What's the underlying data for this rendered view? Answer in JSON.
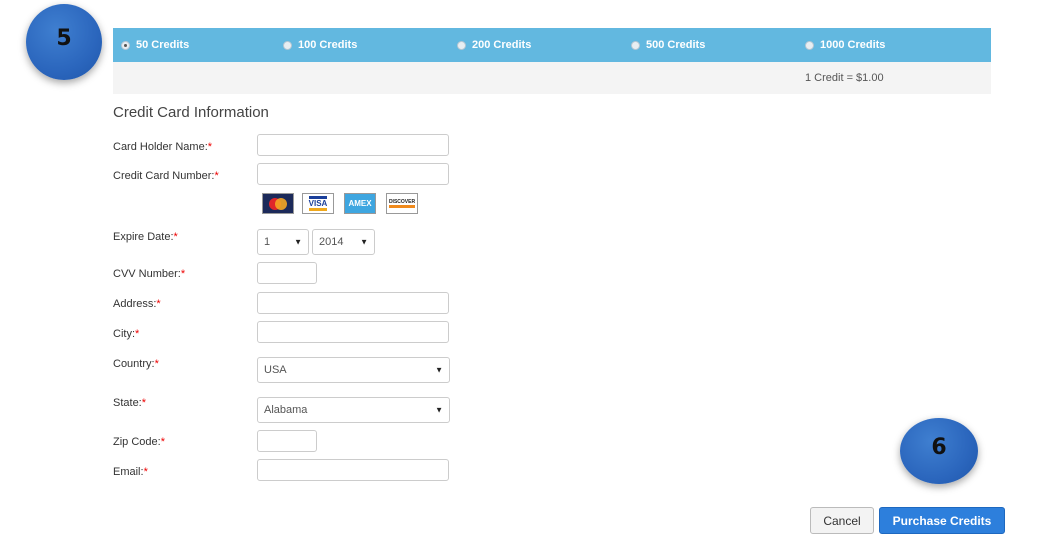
{
  "badges": {
    "step5": "5",
    "step6": "6"
  },
  "credit_options": [
    {
      "label": "50 Credits",
      "selected": true
    },
    {
      "label": "100 Credits",
      "selected": false
    },
    {
      "label": "200 Credits",
      "selected": false
    },
    {
      "label": "500 Credits",
      "selected": false
    },
    {
      "label": "1000 Credits",
      "selected": false
    }
  ],
  "rate_text": "1 Credit = $1.00",
  "form": {
    "title": "Credit Card Information",
    "required_mark": "*",
    "card_holder_label": "Card Holder Name:",
    "card_number_label": "Credit Card Number:",
    "card_logos": [
      "MasterCard",
      "VISA",
      "AMEX",
      "DISCOVER"
    ],
    "expire_label": "Expire Date:",
    "expire_month": "1",
    "expire_year": "2014",
    "cvv_label": "CVV Number:",
    "address_label": "Address:",
    "city_label": "City:",
    "country_label": "Country:",
    "country_value": "USA",
    "state_label": "State:",
    "state_value": "Alabama",
    "zip_label": "Zip Code:",
    "email_label": "Email:"
  },
  "buttons": {
    "cancel": "Cancel",
    "purchase": "Purchase Credits"
  },
  "colors": {
    "credit_bar": "#62b8e0",
    "primary_button": "#2d7fdc",
    "required": "#e00000",
    "badge": "#2b66bd"
  }
}
